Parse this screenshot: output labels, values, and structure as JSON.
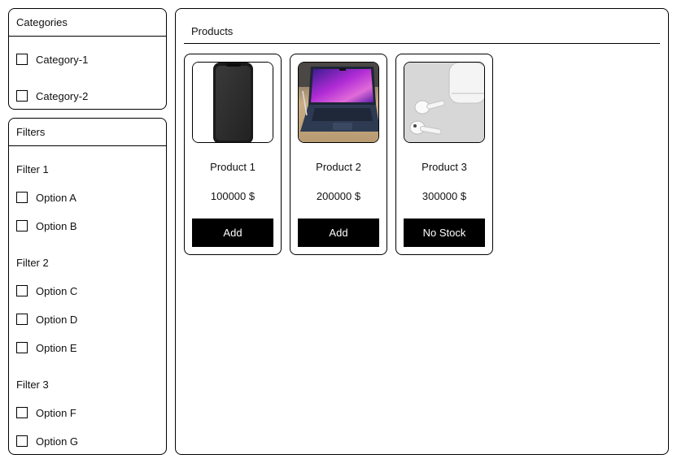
{
  "categories": {
    "title": "Categories",
    "items": [
      {
        "label": "Category-1"
      },
      {
        "label": "Category-2"
      }
    ]
  },
  "filters": {
    "title": "Filters",
    "groups": [
      {
        "title": "Filter 1",
        "options": [
          "Option A",
          "Option B"
        ]
      },
      {
        "title": "Filter 2",
        "options": [
          "Option C",
          "Option D",
          "Option E"
        ]
      },
      {
        "title": "Filter 3",
        "options": [
          "Option F",
          "Option G"
        ]
      }
    ]
  },
  "products": {
    "title": "Products",
    "items": [
      {
        "name": "Product 1",
        "price": "100000 $",
        "button": "Add",
        "icon": "smartphone-image"
      },
      {
        "name": "Product 2",
        "price": "200000 $",
        "button": "Add",
        "icon": "laptop-image"
      },
      {
        "name": "Product 3",
        "price": "300000 $",
        "button": "No Stock",
        "icon": "earbuds-image"
      }
    ]
  }
}
